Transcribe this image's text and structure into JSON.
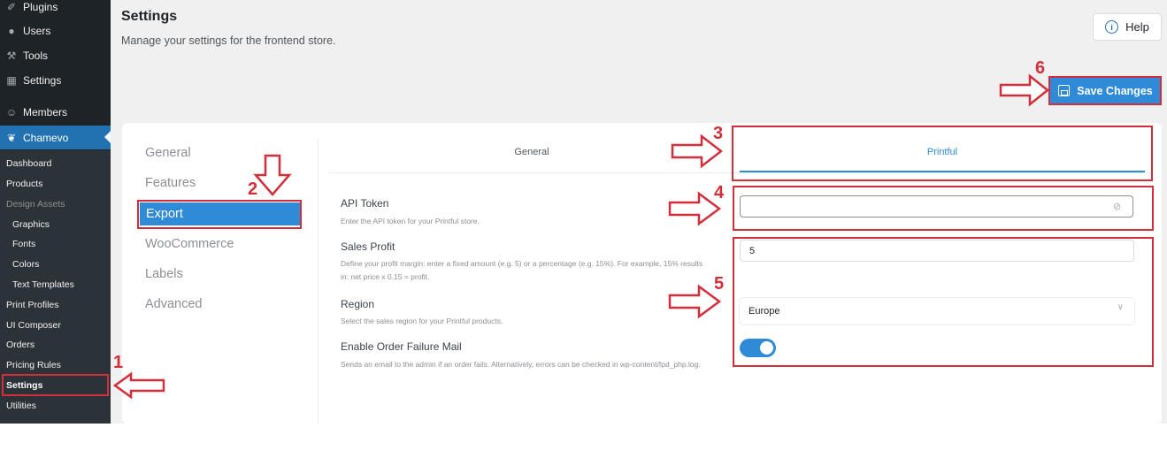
{
  "sidebar": {
    "top_items": [
      {
        "label": "Plugins",
        "icon": "plugin-icon"
      },
      {
        "label": "Users",
        "icon": "users-icon"
      },
      {
        "label": "Tools",
        "icon": "wrench-icon"
      },
      {
        "label": "Settings",
        "icon": "settings-icon"
      },
      {
        "label": "Members",
        "icon": "members-icon"
      },
      {
        "label": "Chamevo",
        "icon": "chamevo-icon"
      }
    ],
    "sub_items": [
      "Dashboard",
      "Products",
      "Design Assets",
      "Graphics",
      "Fonts",
      "Colors",
      "Text Templates",
      "Print Profiles",
      "UI Composer",
      "Orders",
      "Pricing Rules",
      "Settings",
      "Utilities"
    ]
  },
  "header": {
    "title": "Settings",
    "subtitle": "Manage your settings for the frontend store.",
    "help_label": "Help",
    "save_label": "Save Changes"
  },
  "settings_nav": [
    "General",
    "Features",
    "Export",
    "WooCommerce",
    "Labels",
    "Advanced"
  ],
  "tabs": [
    "General",
    "Printful"
  ],
  "fields": {
    "api_token": {
      "label": "API Token",
      "desc": "Enter the API token for your Printful store.",
      "value": ""
    },
    "sales_profit": {
      "label": "Sales Profit",
      "desc": "Define your profit margin: enter a fixed amount (e.g. 5) or a percentage (e.g. 15%). For example, 15% results in: net price x 0.15 = profit.",
      "value": "5"
    },
    "region": {
      "label": "Region",
      "desc": "Select the sales region for your Printful products.",
      "value": "Europe"
    },
    "order_failure_mail": {
      "label": "Enable Order Failure Mail",
      "desc": "Sends an email to the admin if an order fails. Alternatively, errors can be checked in wp-content/fpd_php.log.",
      "enabled": true
    }
  },
  "annotations": [
    "1",
    "2",
    "3",
    "4",
    "5",
    "6"
  ],
  "colors": {
    "accent": "#2f8ad7",
    "annotation": "#d32f3a",
    "sidebar": "#1d2327"
  }
}
